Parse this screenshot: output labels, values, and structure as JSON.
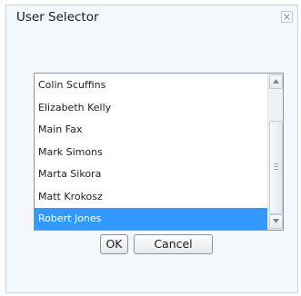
{
  "dialog": {
    "title": "User Selector",
    "close_icon": "close-x-icon"
  },
  "user_list": {
    "items": [
      {
        "label": "Colin Scuffins",
        "selected": false
      },
      {
        "label": "Elizabeth Kelly",
        "selected": false
      },
      {
        "label": "Main Fax",
        "selected": false
      },
      {
        "label": "Mark Simons",
        "selected": false
      },
      {
        "label": "Marta Sikora",
        "selected": false
      },
      {
        "label": "Matt Krokosz",
        "selected": false
      },
      {
        "label": "Robert Jones",
        "selected": true
      }
    ],
    "selection_color": "#3399ff",
    "scrollbar": {
      "up_icon": "triangle-up-icon",
      "down_icon": "triangle-down-icon",
      "grip_icon": "grip-icon"
    }
  },
  "buttons": {
    "ok_label": "OK",
    "cancel_label": "Cancel"
  }
}
